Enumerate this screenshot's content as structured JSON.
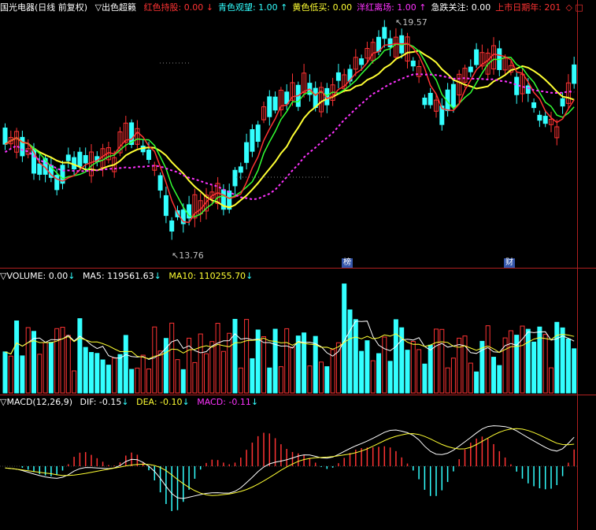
{
  "main_header": {
    "stock": "国光电器(日线 前复权)",
    "indicator_name": "▽出色超籁",
    "items": [
      {
        "label": "红色持股:",
        "value": "0.00",
        "arrow": "↓",
        "color": "#ff3333"
      },
      {
        "label": "青色观望:",
        "value": "1.00",
        "arrow": "↑",
        "color": "#33ffff"
      },
      {
        "label": "黄色低买:",
        "value": "0.00",
        "arrow": "",
        "color": "#ffff33"
      },
      {
        "label": "洋红离场:",
        "value": "1.00",
        "arrow": "↑",
        "color": "#ff33ff"
      },
      {
        "label": "急跌关注:",
        "value": "0.00",
        "arrow": "",
        "color": "#ffffff"
      },
      {
        "label": "上市日期年:",
        "value": "201",
        "arrow": "",
        "color": "#ff3333"
      }
    ],
    "diamond": "◇",
    "square": "□"
  },
  "price_annotations": {
    "high": "19.57",
    "low": "13.76",
    "badge_1": "榜",
    "badge_2": "财"
  },
  "volume_header": {
    "title": "▽VOLUME: 0.00",
    "ma5_label": "MA5: 119561.63",
    "ma10_label": "MA10: 110255.70"
  },
  "macd_header": {
    "title": "▽MACD(12,26,9)",
    "dif_label": "DIF: -0.15",
    "dea_label": "DEA: -0.10",
    "macd_label": "MACD: -0.11"
  },
  "colors": {
    "up": "#ff3333",
    "down": "#33ffff",
    "yellow": "#ffff33",
    "magenta": "#ff33ff",
    "green": "#33ff33",
    "white": "#ffffff",
    "separator": "#b02020"
  }
}
